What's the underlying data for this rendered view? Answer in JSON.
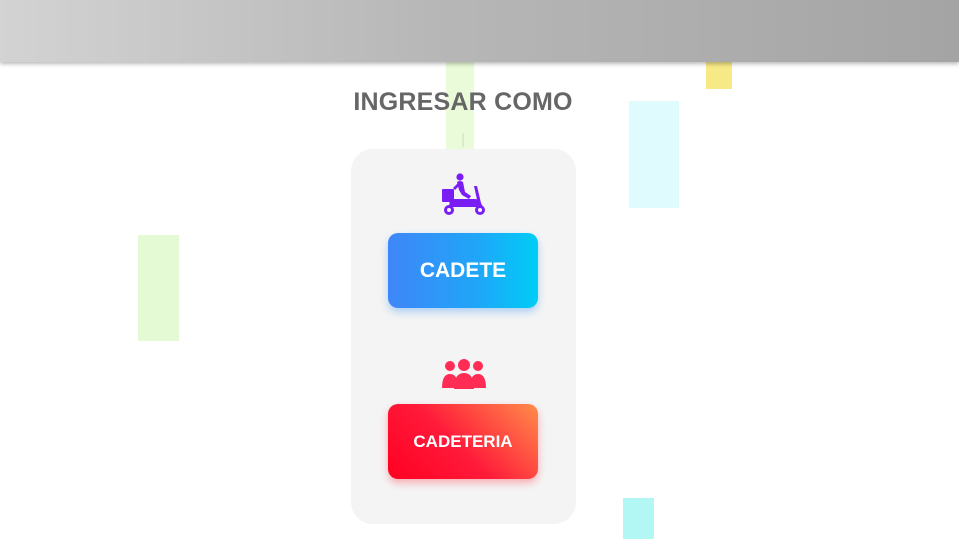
{
  "header": {
    "background": "#b0b0b0"
  },
  "login": {
    "title": "INGRESAR COMO",
    "options": [
      {
        "label": "CADETE",
        "icon": "scooter-icon",
        "icon_color": "#7a1df5",
        "gradient": [
          "#3f86f8",
          "#00cdf6"
        ]
      },
      {
        "label": "CADETERIA",
        "icon": "group-icon",
        "icon_color": "#ff2d55",
        "gradient": [
          "#ff0022",
          "#ff8c4a"
        ]
      }
    ]
  }
}
